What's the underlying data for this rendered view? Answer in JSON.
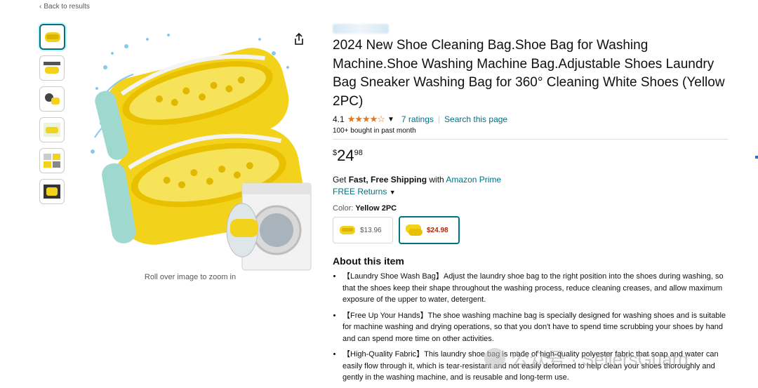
{
  "nav": {
    "back_label": "Back to results"
  },
  "gallery": {
    "zoom_hint": "Roll over image to zoom in",
    "thumbnails": [
      "thumb-1",
      "thumb-2",
      "thumb-3",
      "thumb-4",
      "thumb-5",
      "thumb-6"
    ]
  },
  "product": {
    "title": "2024 New Shoe Cleaning Bag.Shoe Bag for Washing Machine.Shoe Washing Machine Bag.Adjustable Shoes Laundry Bag Sneaker Washing Bag for 360° Cleaning White Shoes (Yellow 2PC)",
    "rating_value": "4.1",
    "stars": "★★★★☆",
    "rating_count": "7 ratings",
    "search_page": "Search this page",
    "bought": "100+ bought in past month",
    "price_symbol": "$",
    "price_whole": "24",
    "price_fraction": "98",
    "shipping_prefix": "Get ",
    "shipping_bold": "Fast, Free Shipping",
    "shipping_mid": " with ",
    "shipping_link": "Amazon Prime",
    "returns": "FREE Returns",
    "color_label": "Color: ",
    "color_value": "Yellow 2PC",
    "swatches": [
      {
        "price": "$13.96"
      },
      {
        "price": "$24.98"
      }
    ],
    "about_heading": "About this item",
    "bullets": [
      "【Laundry Shoe Wash Bag】Adjust the laundry shoe bag to the right position into the shoes during washing, so that the shoes keep their shape throughout the washing process, reduce cleaning creases, and allow maximum exposure of the upper to water, detergent.",
      "【Free Up Your Hands】The shoe washing machine bag is specially designed for washing shoes and is suitable for machine washing and drying operations, so that you don't have to spend time scrubbing your shoes by hand and can spend more time on other activities.",
      "【High-Quality Fabric】This laundry shoe bag is made of high-quality polyester fabric that soap and water can easily flow through it, which is tear-resistant and not easily deformed to help clean your shoes thoroughly and gently in the washing machine, and is reusable and long-term use."
    ]
  },
  "watermark": {
    "text": "公众号 · SellersGuard"
  },
  "colors": {
    "link": "#007185",
    "star": "#DE7921",
    "price_red": "#B12704",
    "yellow": "#F2D21B",
    "mint": "#9fd8cf"
  }
}
